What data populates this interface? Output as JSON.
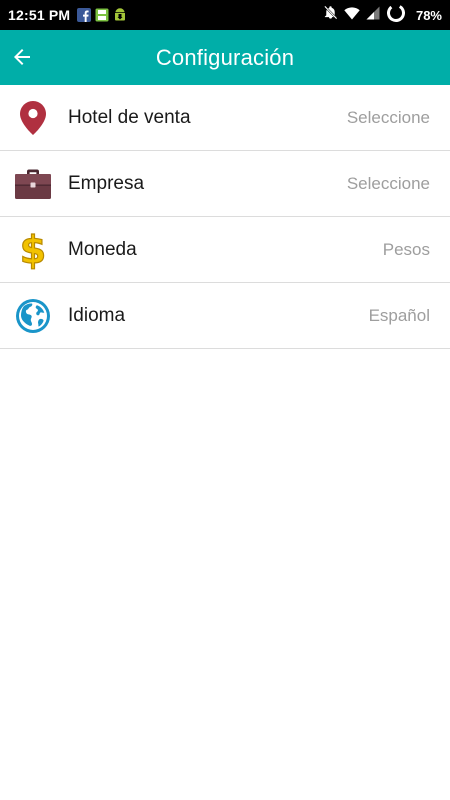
{
  "status_bar": {
    "time": "12:51 PM",
    "battery": "78%",
    "notification_icons": [
      "facebook-icon",
      "save-icon",
      "android-download-icon"
    ],
    "system_icons": [
      "notifications-off-icon",
      "wifi-icon",
      "signal-icon",
      "loading-ring-icon"
    ]
  },
  "app_bar": {
    "title": "Configuración",
    "back_icon": "arrow-left-icon",
    "background_color": "#00aea8"
  },
  "settings": {
    "items": [
      {
        "label": "Hotel de venta",
        "value": "Seleccione",
        "icon": "location-pin-icon",
        "icon_color": "#b03040"
      },
      {
        "label": "Empresa",
        "value": "Seleccione",
        "icon": "briefcase-icon",
        "icon_color": "#6b3a44"
      },
      {
        "label": "Moneda",
        "value": "Pesos",
        "icon": "dollar-icon",
        "icon_color": "#f2c200"
      },
      {
        "label": "Idioma",
        "value": "Español",
        "icon": "globe-icon",
        "icon_color": "#1a95c9"
      }
    ]
  }
}
